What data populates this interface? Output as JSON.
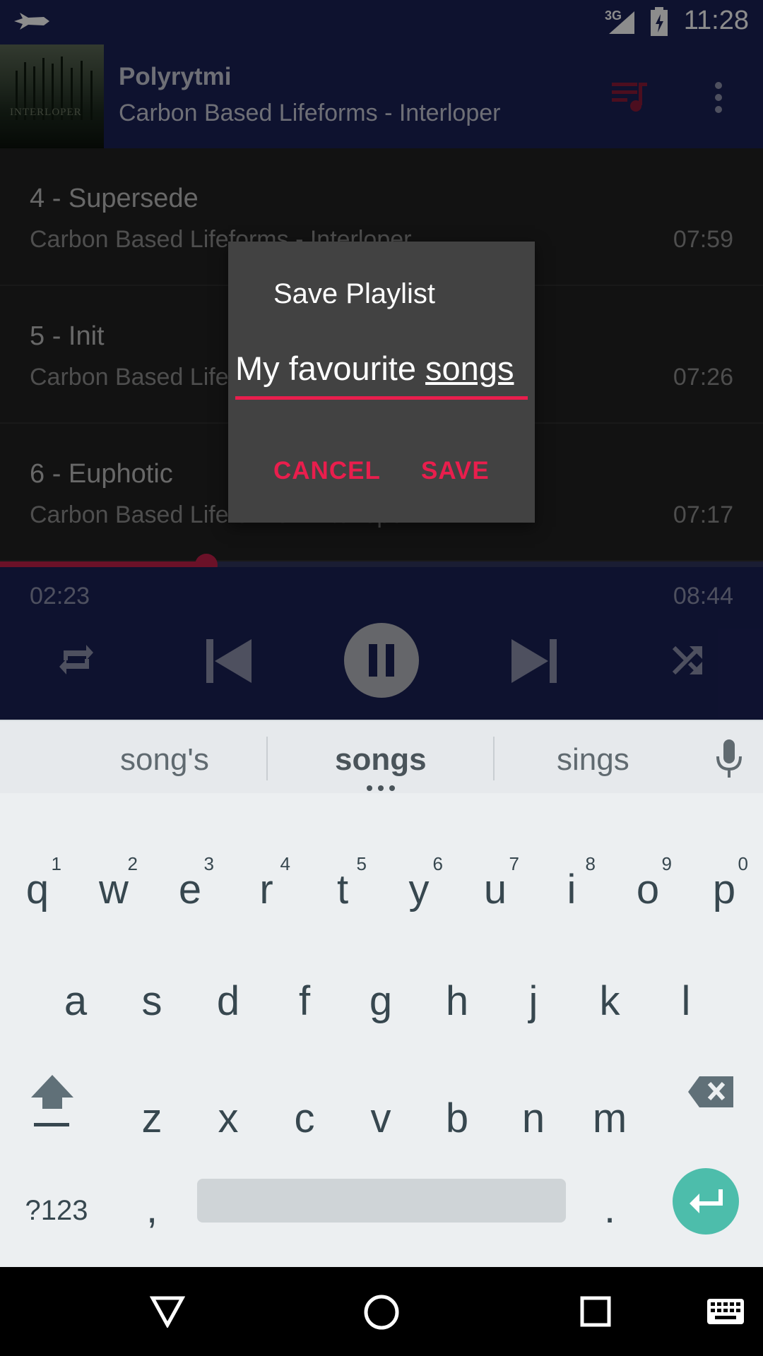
{
  "status_bar": {
    "network": "3G",
    "time": "11:28"
  },
  "now_playing": {
    "title": "Polyrytmi",
    "subtitle": "Carbon Based Lifeforms - Interloper",
    "album_art_text": "INTERLOPER"
  },
  "tracks": [
    {
      "name": "4 - Supersede",
      "artist": "Carbon Based Lifeforms - Interloper",
      "duration": "07:59"
    },
    {
      "name": "5 - Init",
      "artist": "Carbon Based Lifeforms - Interloper",
      "duration": "07:26"
    },
    {
      "name": "6 - Euphotic",
      "artist": "Carbon Based Lifeforms - Interloper",
      "duration": "07:17"
    }
  ],
  "player": {
    "current_time": "02:23",
    "total_time": "08:44",
    "progress": 0.27
  },
  "dialog": {
    "title": "Save Playlist",
    "input_value_prefix": "My favourite ",
    "input_value_word": "songs",
    "cancel_label": "CANCEL",
    "save_label": "SAVE"
  },
  "keyboard": {
    "suggestions": [
      "song's",
      "songs",
      "sings"
    ],
    "row1": [
      {
        "k": "q",
        "h": "1"
      },
      {
        "k": "w",
        "h": "2"
      },
      {
        "k": "e",
        "h": "3"
      },
      {
        "k": "r",
        "h": "4"
      },
      {
        "k": "t",
        "h": "5"
      },
      {
        "k": "y",
        "h": "6"
      },
      {
        "k": "u",
        "h": "7"
      },
      {
        "k": "i",
        "h": "8"
      },
      {
        "k": "o",
        "h": "9"
      },
      {
        "k": "p",
        "h": "0"
      }
    ],
    "row2": [
      "a",
      "s",
      "d",
      "f",
      "g",
      "h",
      "j",
      "k",
      "l"
    ],
    "row3": [
      "z",
      "x",
      "c",
      "v",
      "b",
      "n",
      "m"
    ],
    "symbols_label": "?123",
    "comma": ",",
    "period": "."
  },
  "colors": {
    "accent": "#e91e4d",
    "primary_dark": "#1b2157",
    "enter_key": "#4dbdab"
  }
}
